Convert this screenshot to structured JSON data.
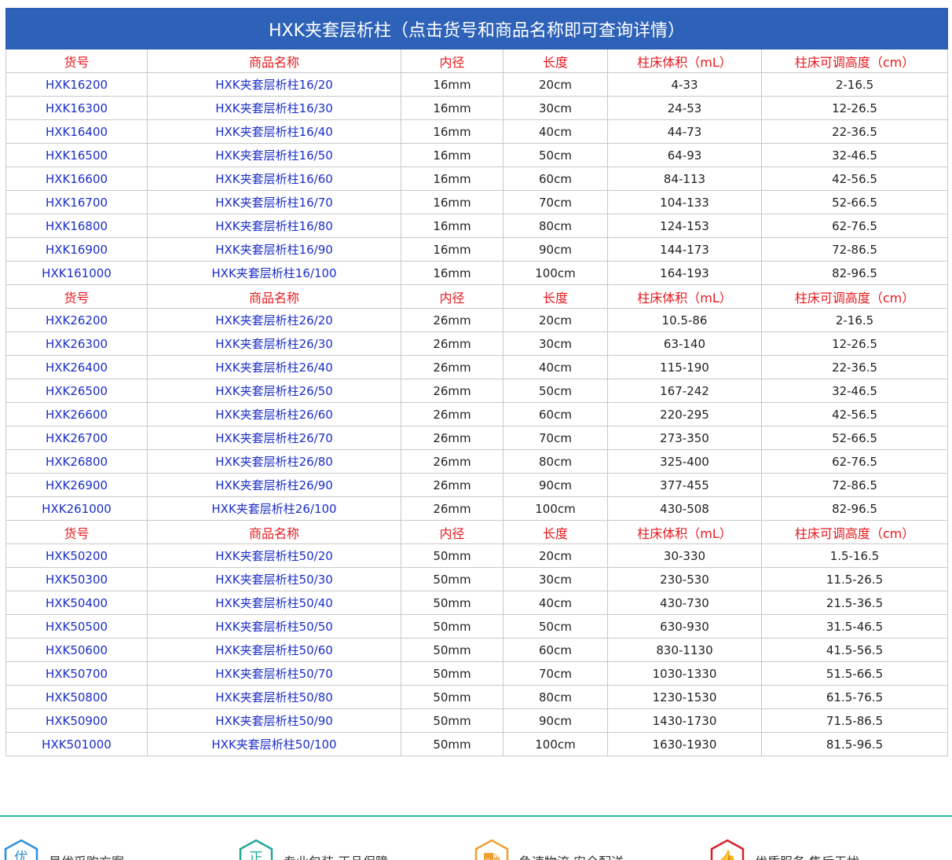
{
  "title": "HXK夹套层析柱（点击货号和商品名称即可查询详情）",
  "headers": [
    "货号",
    "商品名称",
    "内径",
    "长度",
    "柱床体积（mL）",
    "柱床可调高度（cm）"
  ],
  "groups": [
    {
      "rows": [
        [
          "HXK16200",
          "HXK夹套层析柱16/20",
          "16mm",
          "20cm",
          "4-33",
          "2-16.5"
        ],
        [
          "HXK16300",
          "HXK夹套层析柱16/30",
          "16mm",
          "30cm",
          "24-53",
          "12-26.5"
        ],
        [
          "HXK16400",
          "HXK夹套层析柱16/40",
          "16mm",
          "40cm",
          "44-73",
          "22-36.5"
        ],
        [
          "HXK16500",
          "HXK夹套层析柱16/50",
          "16mm",
          "50cm",
          "64-93",
          "32-46.5"
        ],
        [
          "HXK16600",
          "HXK夹套层析柱16/60",
          "16mm",
          "60cm",
          "84-113",
          "42-56.5"
        ],
        [
          "HXK16700",
          "HXK夹套层析柱16/70",
          "16mm",
          "70cm",
          "104-133",
          "52-66.5"
        ],
        [
          "HXK16800",
          "HXK夹套层析柱16/80",
          "16mm",
          "80cm",
          "124-153",
          "62-76.5"
        ],
        [
          "HXK16900",
          "HXK夹套层析柱16/90",
          "16mm",
          "90cm",
          "144-173",
          "72-86.5"
        ],
        [
          "HXK161000",
          "HXK夹套层析柱16/100",
          "16mm",
          "100cm",
          "164-193",
          "82-96.5"
        ]
      ]
    },
    {
      "rows": [
        [
          "HXK26200",
          "HXK夹套层析柱26/20",
          "26mm",
          "20cm",
          "10.5-86",
          "2-16.5"
        ],
        [
          "HXK26300",
          "HXK夹套层析柱26/30",
          "26mm",
          "30cm",
          "63-140",
          "12-26.5"
        ],
        [
          "HXK26400",
          "HXK夹套层析柱26/40",
          "26mm",
          "40cm",
          "115-190",
          "22-36.5"
        ],
        [
          "HXK26500",
          "HXK夹套层析柱26/50",
          "26mm",
          "50cm",
          "167-242",
          "32-46.5"
        ],
        [
          "HXK26600",
          "HXK夹套层析柱26/60",
          "26mm",
          "60cm",
          "220-295",
          "42-56.5"
        ],
        [
          "HXK26700",
          "HXK夹套层析柱26/70",
          "26mm",
          "70cm",
          "273-350",
          "52-66.5"
        ],
        [
          "HXK26800",
          "HXK夹套层析柱26/80",
          "26mm",
          "80cm",
          "325-400",
          "62-76.5"
        ],
        [
          "HXK26900",
          "HXK夹套层析柱26/90",
          "26mm",
          "90cm",
          "377-455",
          "72-86.5"
        ],
        [
          "HXK261000",
          "HXK夹套层析柱26/100",
          "26mm",
          "100cm",
          "430-508",
          "82-96.5"
        ]
      ]
    },
    {
      "rows": [
        [
          "HXK50200",
          "HXK夹套层析柱50/20",
          "50mm",
          "20cm",
          "30-330",
          "1.5-16.5"
        ],
        [
          "HXK50300",
          "HXK夹套层析柱50/30",
          "50mm",
          "30cm",
          "230-530",
          "11.5-26.5"
        ],
        [
          "HXK50400",
          "HXK夹套层析柱50/40",
          "50mm",
          "40cm",
          "430-730",
          "21.5-36.5"
        ],
        [
          "HXK50500",
          "HXK夹套层析柱50/50",
          "50mm",
          "50cm",
          "630-930",
          "31.5-46.5"
        ],
        [
          "HXK50600",
          "HXK夹套层析柱50/60",
          "50mm",
          "60cm",
          "830-1130",
          "41.5-56.5"
        ],
        [
          "HXK50700",
          "HXK夹套层析柱50/70",
          "50mm",
          "70cm",
          "1030-1330",
          "51.5-66.5"
        ],
        [
          "HXK50800",
          "HXK夹套层析柱50/80",
          "50mm",
          "80cm",
          "1230-1530",
          "61.5-76.5"
        ],
        [
          "HXK50900",
          "HXK夹套层析柱50/90",
          "50mm",
          "90cm",
          "1430-1730",
          "71.5-86.5"
        ],
        [
          "HXK501000",
          "HXK夹套层析柱50/100",
          "50mm",
          "100cm",
          "1630-1930",
          "81.5-96.5"
        ]
      ]
    }
  ],
  "features": [
    {
      "glyph": "优",
      "text": "最优采购方案",
      "color": "#2e8fd8",
      "icon": "hexagon-badge-icon"
    },
    {
      "glyph": "正",
      "text": "专业包装 正品保障",
      "color": "#21a898",
      "icon": "hexagon-badge-icon"
    },
    {
      "glyph": "⛟",
      "text": "急速物流 安全配送",
      "color": "#f0a030",
      "icon": "delivery-truck-icon"
    },
    {
      "glyph": "👍",
      "text": "优质服务 售后无忧",
      "color": "#d8202a",
      "icon": "thumbs-up-icon"
    }
  ],
  "colors": {
    "title_bg": "#2e62b8",
    "header_text": "#e8191e",
    "link_text": "#1a2ec8",
    "footer_line": "#27b8a8"
  }
}
